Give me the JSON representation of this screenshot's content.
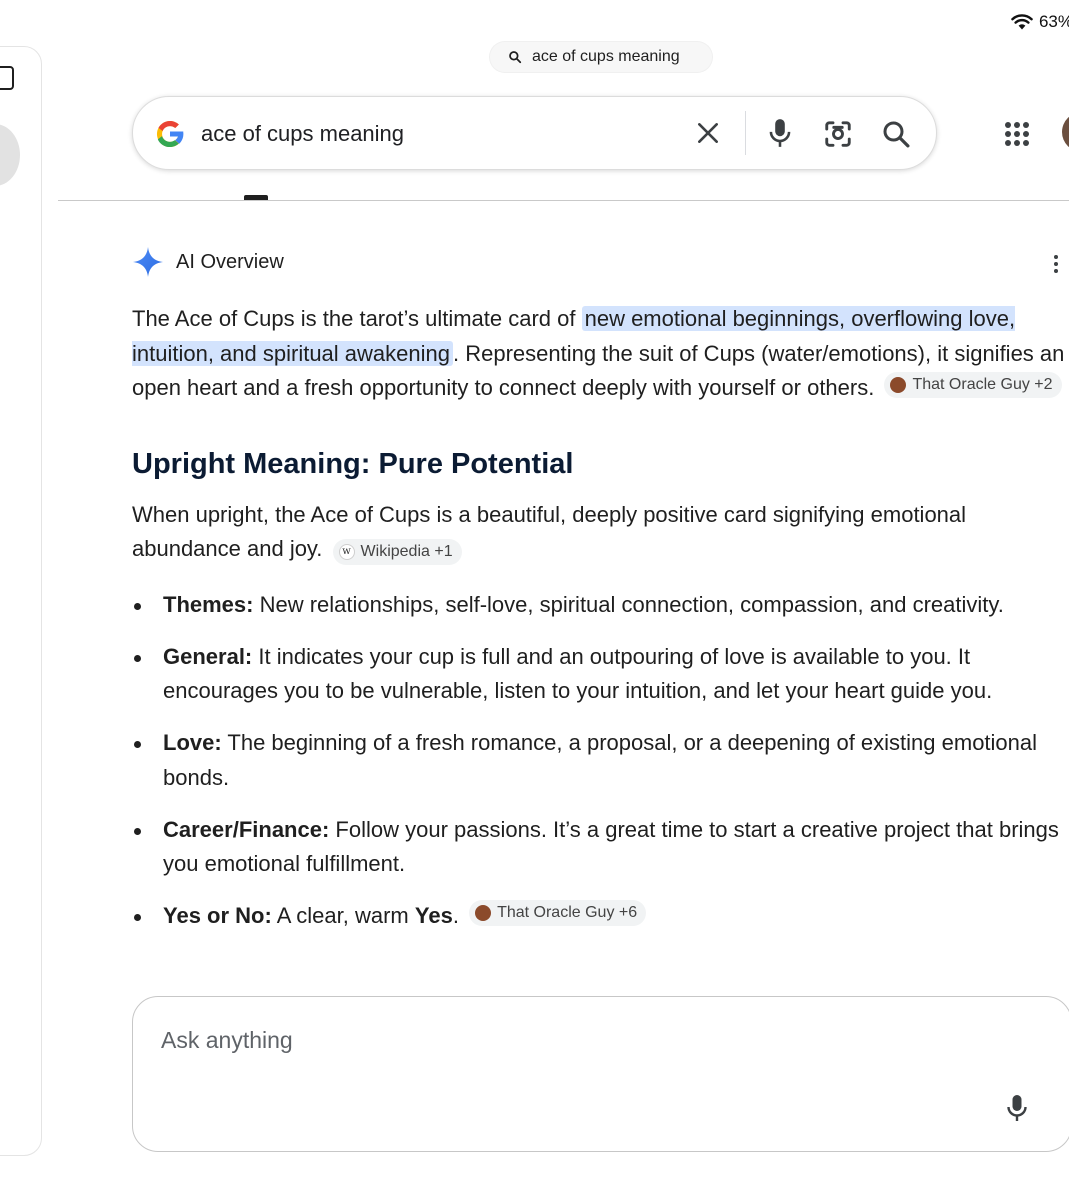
{
  "status": {
    "battery": "63%"
  },
  "url_pill": {
    "text": "ace of cups meaning"
  },
  "search": {
    "query": "ace of cups meaning"
  },
  "ai_overview": {
    "label": "AI Overview",
    "intro_before": "The Ace of Cups is the tarot’s ultimate card of ",
    "intro_highlight": "new emotional beginnings, overflowing love, intuition, and spiritual awakening",
    "intro_after": ". Representing the suit of Cups (water/emotions), it signifies an open heart and a fresh opportunity to connect deeply with yourself or others.",
    "intro_source": "That Oracle Guy +2",
    "section_title": "Upright Meaning: Pure Potential",
    "upright_text": "When upright, the Ace of Cups is a beautiful, deeply positive card signifying emotional abundance and joy.",
    "upright_source": "Wikipedia +1",
    "wiki_letter": "w",
    "bullets": [
      {
        "label": "Themes:",
        "text": " New relationships, self-love, spiritual connection, compassion, and creativity."
      },
      {
        "label": "General:",
        "text": " It indicates your cup is full and an outpouring of love is available to you. It encourages you to be vulnerable, listen to your intuition, and let your heart guide you."
      },
      {
        "label": "Love:",
        "text": " The beginning of a fresh romance, a proposal, or a deepening of existing emotional bonds."
      },
      {
        "label": "Career/Finance:",
        "text": " Follow your passions. It’s a great time to start a creative project that brings you emotional fulfillment."
      }
    ],
    "yes_no": {
      "label": "Yes or No:",
      "text": " A clear, warm ",
      "answer": "Yes",
      "period": ".",
      "source": "That Oracle Guy +6"
    }
  },
  "ask": {
    "placeholder": "Ask anything"
  },
  "colors": {
    "highlight": "#d3e3fd",
    "google_blue": "#4285F4",
    "google_red": "#EA4335",
    "google_yellow": "#FBBC05",
    "google_green": "#34A853"
  }
}
